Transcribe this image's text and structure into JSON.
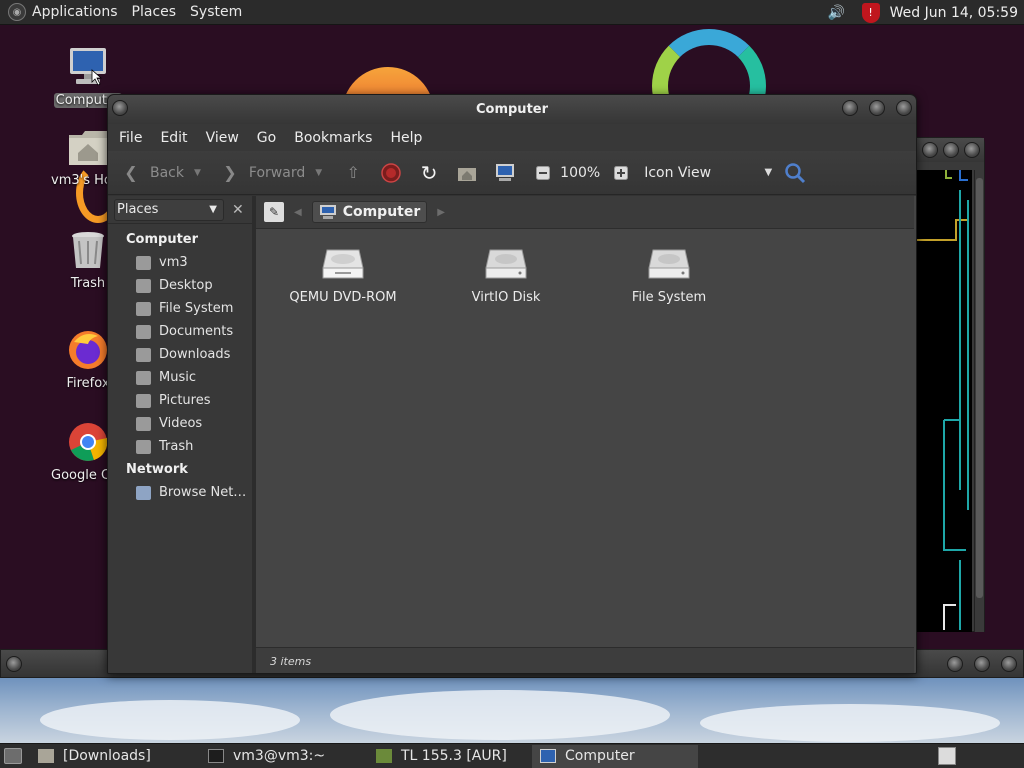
{
  "top_panel": {
    "menus": [
      "Applications",
      "Places",
      "System"
    ],
    "clock": "Wed Jun 14, 05:59",
    "icons": {
      "apps": "apps-icon",
      "volume": "volume-icon",
      "security": "shield-icon"
    }
  },
  "desktop": {
    "icons": [
      {
        "label": "Computer",
        "icon": "computer-icon"
      },
      {
        "label": "vm3's Home",
        "icon": "home-folder-icon"
      },
      {
        "label": "Trash",
        "icon": "trash-icon"
      },
      {
        "label": "Firefox",
        "icon": "firefox-icon"
      },
      {
        "label": "Google Chrome",
        "icon": "chrome-icon"
      }
    ]
  },
  "window": {
    "title": "Computer",
    "menus": [
      "File",
      "Edit",
      "View",
      "Go",
      "Bookmarks",
      "Help"
    ],
    "toolbar": {
      "back": "Back",
      "forward": "Forward",
      "zoom": "100%",
      "view_mode": "Icon View"
    },
    "sidebar": {
      "selector": "Places",
      "sections": [
        {
          "title": "Computer",
          "items": [
            "vm3",
            "Desktop",
            "File System",
            "Documents",
            "Downloads",
            "Music",
            "Pictures",
            "Videos",
            "Trash"
          ]
        },
        {
          "title": "Network",
          "items": [
            "Browse Net…"
          ]
        }
      ]
    },
    "pathbar": {
      "location": "Computer"
    },
    "items": [
      {
        "label": "QEMU DVD-ROM",
        "icon": "dvd-drive-icon"
      },
      {
        "label": "VirtIO Disk",
        "icon": "hard-disk-icon"
      },
      {
        "label": "File System",
        "icon": "hard-disk-icon"
      }
    ],
    "status": "3 items"
  },
  "taskbar": {
    "tasks": [
      {
        "label": "[Downloads]",
        "active": false
      },
      {
        "label": "vm3@vm3:~",
        "active": false
      },
      {
        "label": "TL 155.3 [AUR]",
        "active": false
      },
      {
        "label": "Computer",
        "active": true
      }
    ]
  }
}
